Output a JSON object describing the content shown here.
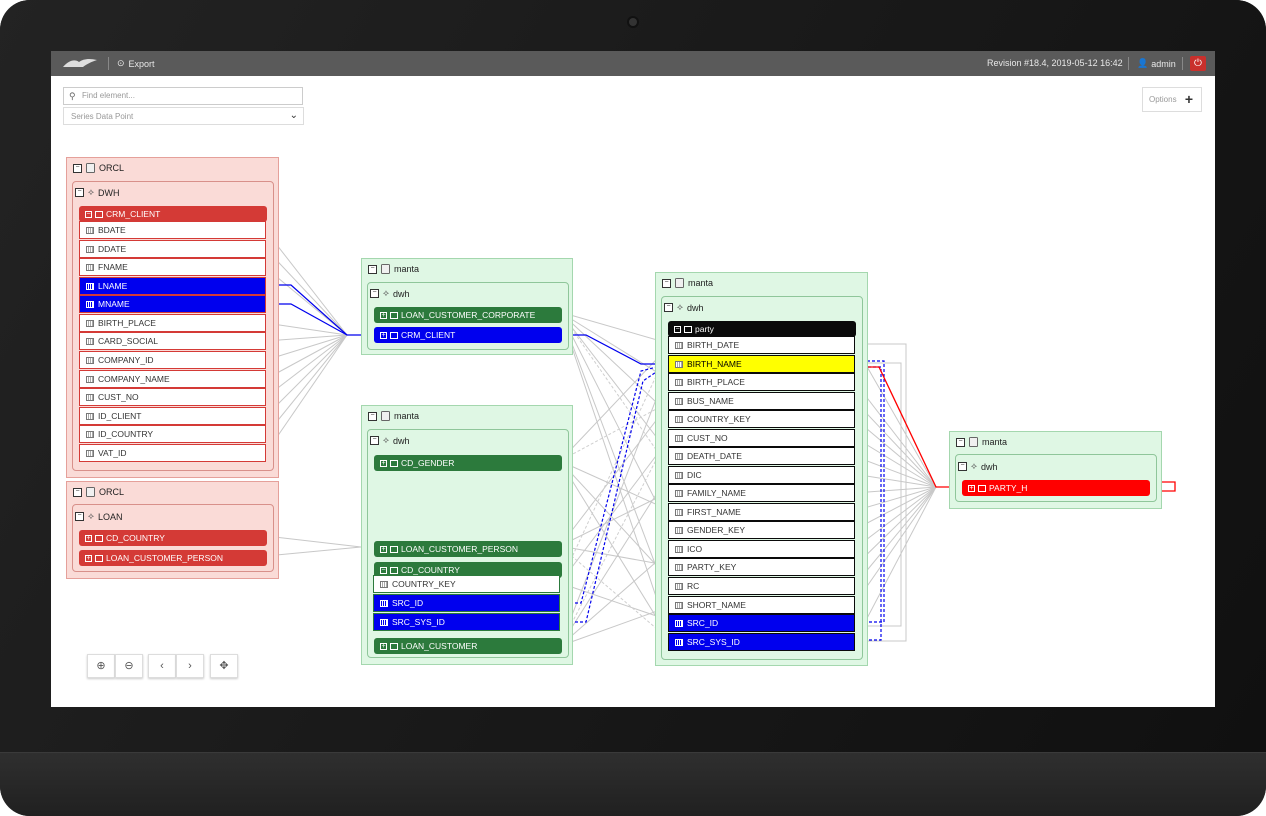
{
  "topbar": {
    "export_label": "Export",
    "revision": "Revision #18.4, 2019-05-12 16:42",
    "user": "admin"
  },
  "search": {
    "placeholder": "Find element..."
  },
  "filter": {
    "selected": "Series Data Point"
  },
  "options_label": "Options",
  "orcl1": {
    "db": "ORCL",
    "schema": "DWH",
    "table": "CRM_CLIENT",
    "columns": [
      "BDATE",
      "DDATE",
      "FNAME",
      "LNAME",
      "MNAME",
      "BIRTH_PLACE",
      "CARD_SOCIAL",
      "COMPANY_ID",
      "COMPANY_NAME",
      "CUST_NO",
      "ID_CLIENT",
      "ID_COUNTRY",
      "VAT_ID"
    ]
  },
  "orcl2": {
    "db": "ORCL",
    "schema": "LOAN",
    "tables": [
      "CD_COUNTRY",
      "LOAN_CUSTOMER_PERSON"
    ]
  },
  "manta1": {
    "db": "manta",
    "schema": "dwh",
    "tables": [
      "LOAN_CUSTOMER_CORPORATE",
      "CRM_CLIENT"
    ]
  },
  "manta2": {
    "db": "manta",
    "schema": "dwh",
    "tables": [
      "CD_GENDER",
      "LOAN_CUSTOMER_PERSON",
      "CD_COUNTRY",
      "LOAN_CUSTOMER"
    ],
    "cd_country_columns": [
      "COUNTRY_KEY",
      "SRC_ID",
      "SRC_SYS_ID"
    ]
  },
  "manta3": {
    "db": "manta",
    "schema": "dwh",
    "table": "party",
    "columns": [
      "BIRTH_DATE",
      "BIRTH_NAME",
      "BIRTH_PLACE",
      "BUS_NAME",
      "COUNTRY_KEY",
      "CUST_NO",
      "DEATH_DATE",
      "DIC",
      "FAMILY_NAME",
      "FIRST_NAME",
      "GENDER_KEY",
      "ICO",
      "PARTY_KEY",
      "RC",
      "SHORT_NAME",
      "SRC_ID",
      "SRC_SYS_ID"
    ]
  },
  "manta4": {
    "db": "manta",
    "schema": "dwh",
    "table": "PARTY_H"
  },
  "colors": {
    "highlight_blue": "#0000ee",
    "highlight_yellow": "#ffff00",
    "target_red": "#ff0000",
    "source_red": "#d43a36",
    "table_green": "#2c7a3c"
  }
}
